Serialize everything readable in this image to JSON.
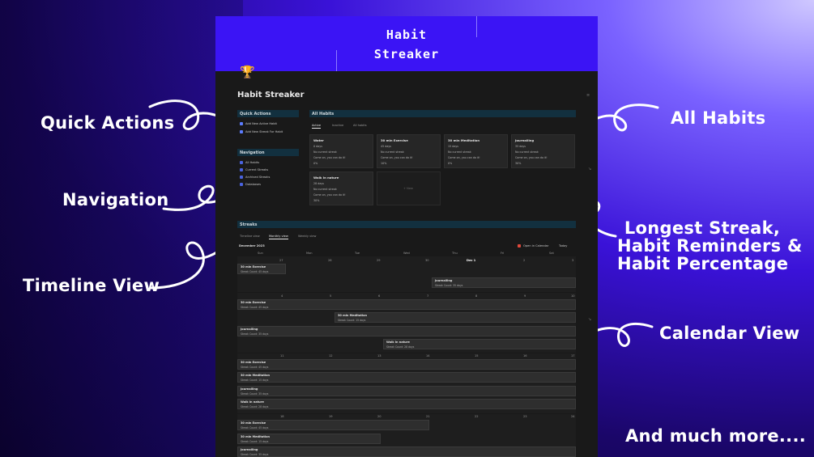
{
  "annotations": {
    "quick_actions": "Quick Actions",
    "navigation": "Navigation",
    "timeline_view": "Timeline View",
    "all_habits": "All Habits",
    "longest_streak_1": "Longest Streak,",
    "longest_streak_2": "Habit Reminders &",
    "longest_streak_3": "Habit Percentage",
    "calendar_view": "Calendar View",
    "much_more": "And much more...."
  },
  "cover": {
    "title_line1": "Habit",
    "title_line2": "Streaker"
  },
  "page": {
    "title": "Habit Streaker"
  },
  "quick_actions": {
    "heading": "Quick Actions",
    "items": [
      "Add New Active Habit",
      "Add New Streak For Habit"
    ]
  },
  "navigation": {
    "heading": "Navigation",
    "items": [
      "All Habits",
      "Current Streaks",
      "Archived Streaks",
      "Databases"
    ]
  },
  "all_habits": {
    "heading": "All Habits",
    "tabs": [
      "Active",
      "Inactive",
      "All habits"
    ],
    "cards": [
      {
        "title": "Water",
        "days": "0 days",
        "streak": "No current streak",
        "prompt": "Come on, you can do it!",
        "pct": "0%"
      },
      {
        "title": "30 min Exercise",
        "days": "45 days",
        "streak": "No current streak",
        "prompt": "Come on, you can do it!",
        "pct": "10%"
      },
      {
        "title": "30 min Meditation",
        "days": "15 days",
        "streak": "No current streak",
        "prompt": "Come on, you can do it!",
        "pct": "0%"
      },
      {
        "title": "Journalling",
        "days": "35 days",
        "streak": "No current streak",
        "prompt": "Come on, you can do it!",
        "pct": "30%"
      },
      {
        "title": "Walk in nature",
        "days": "28 days",
        "streak": "No current streak",
        "prompt": "Come on, you can do it!",
        "pct": "30%"
      }
    ],
    "new_label": "+ New"
  },
  "streaks": {
    "heading": "Streaks",
    "tabs": [
      "Timeline view",
      "Monthly view",
      "Weekly view"
    ],
    "month": "December 2023",
    "open_calendar": "Open in Calendar",
    "today": "Today",
    "weekdays": [
      "Sun",
      "Mon",
      "Tue",
      "Wed",
      "Thu",
      "Fri",
      "Sat"
    ],
    "week1": [
      "26",
      "27",
      "28",
      "29",
      "30",
      "Dec 1",
      "2"
    ],
    "week1_end": "3",
    "week2": [
      "4",
      "5",
      "6",
      "7",
      "8",
      "9",
      "10"
    ],
    "week3": [
      "11",
      "12",
      "13",
      "14",
      "15",
      "16",
      "17"
    ],
    "week4": [
      "18",
      "19",
      "20",
      "21",
      "22",
      "23",
      "24"
    ],
    "events": {
      "w1_a_name": "30 min Exercise",
      "w1_a_count": "Streak Count: 45 days",
      "w1_b_name": "Journalling",
      "w1_b_count": "Streak Count: 35 days",
      "w2_a_name": "30 min Exercise",
      "w2_a_count": "Streak Count: 45 days",
      "w2_b_name": "30 min Meditation",
      "w2_b_count": "Streak Count: 15 days",
      "w2_c_name": "Journalling",
      "w2_c_count": "Streak Count: 35 days",
      "w2_d_name": "Walk in nature",
      "w2_d_count": "Streak Count: 28 days",
      "w3_a_name": "30 min Exercise",
      "w3_a_count": "Streak Count: 45 days",
      "w3_b_name": "30 min Meditation",
      "w3_b_count": "Streak Count: 15 days",
      "w3_c_name": "Journalling",
      "w3_c_count": "Streak Count: 35 days",
      "w3_d_name": "Walk in nature",
      "w3_d_count": "Streak Count: 28 days",
      "w4_a_name": "30 min Exercise",
      "w4_a_count": "Streak Count: 45 days",
      "w4_b_name": "30 min Meditation",
      "w4_b_count": "Streak Count: 15 days",
      "w4_c_name": "Journalling",
      "w4_c_count": "Streak Count: 35 days"
    }
  }
}
